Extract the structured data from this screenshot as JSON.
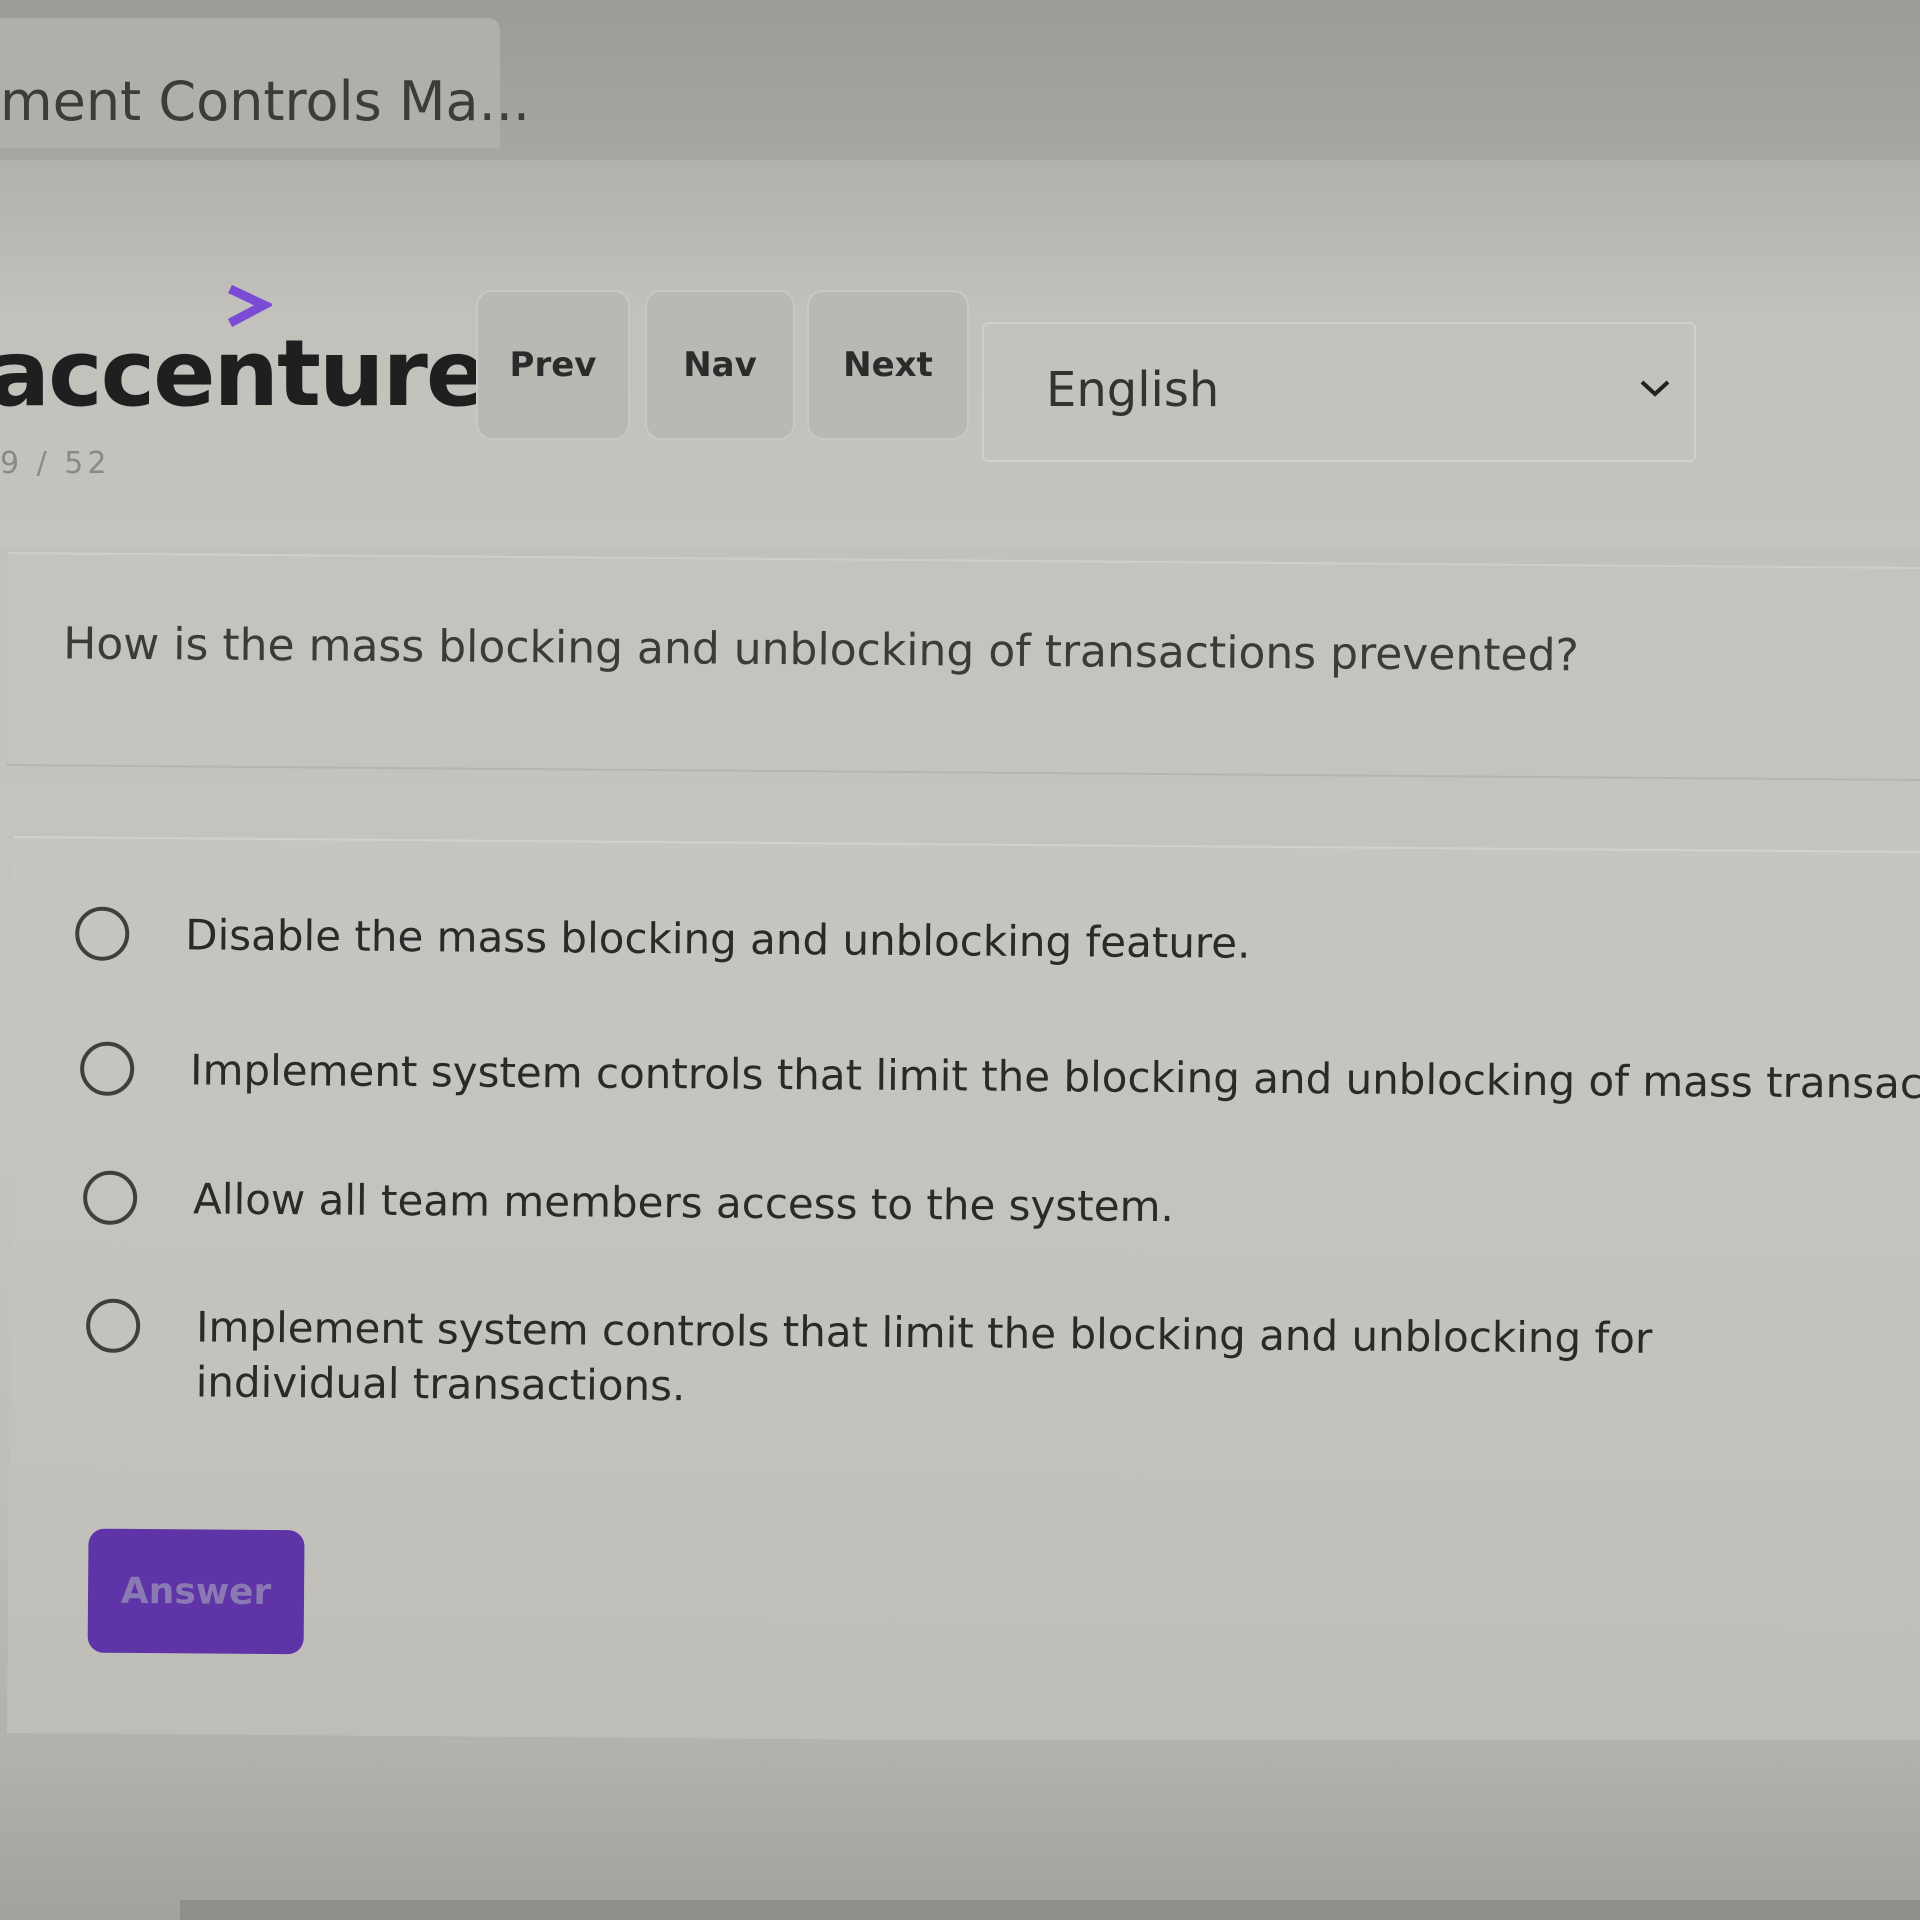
{
  "browser": {
    "tab_title": "ment Controls Ma..."
  },
  "header": {
    "logo_text": "accenture",
    "logo_accent_color": "#7b4bd6",
    "counter": "9 / 52",
    "prev_label": "Prev",
    "nav_label": "Nav",
    "next_label": "Next",
    "language": {
      "selected": "English",
      "icon": "chevron-down-icon"
    }
  },
  "question": {
    "text": "How is the mass blocking and unblocking of transactions prevented?"
  },
  "options": [
    {
      "label": "Disable the mass blocking and unblocking feature.",
      "selected": false
    },
    {
      "label": "Implement system controls that limit the blocking and unblocking of mass transactions.",
      "selected": false
    },
    {
      "label": "Allow all team members access to the system.",
      "selected": false
    },
    {
      "label": "Implement system controls that limit the blocking and unblocking for individual transactions.",
      "selected": false
    }
  ],
  "answer_button": {
    "label": "Answer",
    "color": "#5e34a6"
  }
}
